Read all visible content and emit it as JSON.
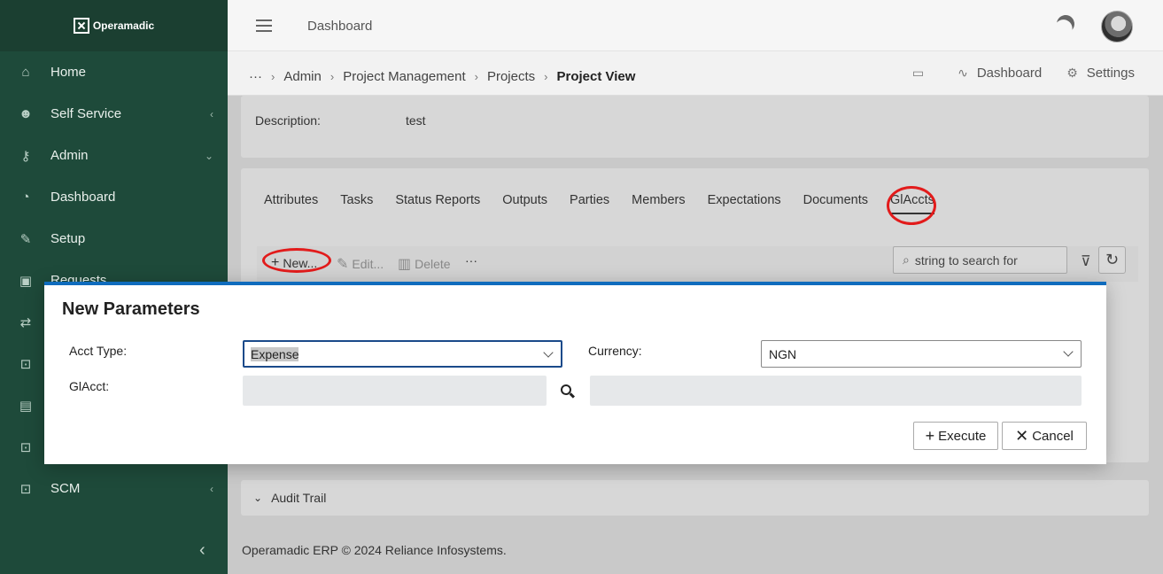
{
  "app": {
    "logo_text": "Operamadic"
  },
  "sidebar": {
    "items": [
      {
        "label": "Home",
        "icon": "home-icon",
        "chevron": ""
      },
      {
        "label": "Self Service",
        "icon": "user-gear-icon",
        "chevron": "‹"
      },
      {
        "label": "Admin",
        "icon": "key-icon",
        "chevron": "⌄"
      },
      {
        "label": "Dashboard",
        "icon": "gauge-icon",
        "chevron": ""
      },
      {
        "label": "Setup",
        "icon": "wrench-icon",
        "chevron": ""
      },
      {
        "label": "Requests",
        "icon": "archive-icon",
        "chevron": ""
      },
      {
        "label": "SCM",
        "icon": "contact-card-icon",
        "chevron": "‹"
      }
    ]
  },
  "topbar": {
    "title": "Dashboard"
  },
  "breadcrumb": {
    "items": [
      "Admin",
      "Project Management",
      "Projects"
    ],
    "current": "Project View",
    "actions": {
      "dashboard": "Dashboard",
      "settings": "Settings"
    }
  },
  "description": {
    "label": "Description:",
    "value": "test"
  },
  "tabs": [
    "Attributes",
    "Tasks",
    "Status Reports",
    "Outputs",
    "Parties",
    "Members",
    "Expectations",
    "Documents",
    "GlAccts"
  ],
  "toolbar": {
    "new_label": "New...",
    "edit_label": "Edit...",
    "delete_label": "Delete",
    "more_label": "···",
    "search_placeholder": "string to search for"
  },
  "audit": {
    "label": "Audit Trail"
  },
  "footer": {
    "text": "Operamadic ERP © 2024 Reliance Infosystems."
  },
  "modal": {
    "title": "New Parameters",
    "acct_type_label": "Acct Type:",
    "acct_type_value": "Expense",
    "currency_label": "Currency:",
    "currency_value": "NGN",
    "glacct_label": "GlAcct:",
    "execute_label": "Execute",
    "cancel_label": "Cancel"
  },
  "colors": {
    "sidebar_bg": "#1e4a3a",
    "accent": "#0f6cbd",
    "annotation_ring": "#e21b1b"
  }
}
